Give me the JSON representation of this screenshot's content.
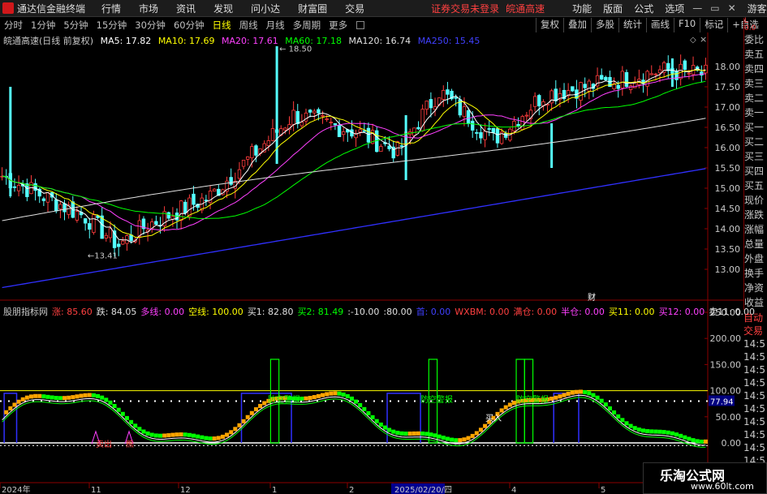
{
  "app": {
    "title": "通达信金融终端",
    "menu": [
      "行情",
      "市场",
      "资讯",
      "发现",
      "问小达",
      "财富圈",
      "交易"
    ],
    "warning": "证券交易未登录",
    "stock": "皖通高速",
    "right_menu": [
      "功能",
      "版面",
      "公式",
      "选项"
    ],
    "right_extra": [
      "游客"
    ]
  },
  "periods": [
    "分时",
    "1分钟",
    "5分钟",
    "15分钟",
    "30分钟",
    "60分钟",
    "日线",
    "周线",
    "月线",
    "多周期",
    "更多"
  ],
  "active_period": "日线",
  "toolbar": [
    "复权",
    "叠加",
    "多股",
    "统计",
    "画线",
    "F10",
    "标记",
    "+自选"
  ],
  "main_legend": {
    "name": "皖通高速(日线 前复权)",
    "items": [
      {
        "label": "MA5: 17.82",
        "color": "#ffffff"
      },
      {
        "label": "MA10: 17.69",
        "color": "#ffff00"
      },
      {
        "label": "MA20: 17.61",
        "color": "#ff40ff"
      },
      {
        "label": "MA60: 17.18",
        "color": "#00ff00"
      },
      {
        "label": "MA120: 16.74",
        "color": "#e0e0e0"
      },
      {
        "label": "MA250: 15.45",
        "color": "#4040ff"
      }
    ]
  },
  "sub_legend": {
    "name": "股朋指标网",
    "items": [
      {
        "label": "涨: 85.60",
        "color": "#ff4040"
      },
      {
        "label": "跌: 84.05",
        "color": "#e0e0e0"
      },
      {
        "label": "多线: 0.00",
        "color": "#ff40ff"
      },
      {
        "label": "空线: 100.00",
        "color": "#ffff00"
      },
      {
        "label": "买1: 82.80",
        "color": "#e0e0e0"
      },
      {
        "label": "买2: 81.49",
        "color": "#00ff00"
      },
      {
        "label": ":-10.00",
        "color": "#e0e0e0"
      },
      {
        "label": ":80.00",
        "color": "#e0e0e0"
      },
      {
        "label": "首: 0.00",
        "color": "#4040ff"
      },
      {
        "label": "WXBM: 0.00",
        "color": "#ff4040"
      },
      {
        "label": "满仓: 0.00",
        "color": "#ff4040"
      },
      {
        "label": "半仓: 0.00",
        "color": "#ff40ff"
      },
      {
        "label": "买11: 0.00",
        "color": "#ffff00"
      },
      {
        "label": "买12: 0.00",
        "color": "#ff40ff"
      },
      {
        "label": "卖11: 0.00",
        "color": "#e0e0e0"
      }
    ]
  },
  "price_axis": [
    "18.00",
    "17.50",
    "17.00",
    "16.50",
    "16.00",
    "15.50",
    "15.00",
    "14.50",
    "14.00",
    "13.50",
    "13.00"
  ],
  "sub_axis": [
    "250.00",
    "200.00",
    "150.00",
    "100.00",
    "50.00",
    "0.00"
  ],
  "sub_axis_right": [
    "14:5",
    "14:5",
    "14:5",
    "14:5",
    "14:5",
    "14:5",
    "14:5",
    "14:5",
    "14:5",
    "14:5",
    "14:5",
    "14:5"
  ],
  "date_labels": [
    "2024年",
    "11",
    "12",
    "1",
    "2",
    "2025/02/20/四",
    "4",
    "5"
  ],
  "annotations": {
    "high": "18.50",
    "low": "13.41",
    "cai": "财",
    "current": "77.94",
    "fangkong": "防空警报",
    "maichu": "卖出",
    "mairu": "买入",
    "xiong": "熊"
  },
  "right_panel": [
    "委比",
    "卖五",
    "卖四",
    "卖三",
    "卖二",
    "卖一",
    "买一",
    "买二",
    "买三",
    "买四",
    "买五",
    "现价",
    "涨跌",
    "涨幅",
    "总量",
    "外盘",
    "换手",
    "净资",
    "收益"
  ],
  "right_panel_top": [
    "L",
    "0.0"
  ],
  "right_panel2": [
    "自动",
    "交易"
  ],
  "watermark": {
    "big": "乐淘公式网",
    "small": "www.60lt.com"
  }
}
